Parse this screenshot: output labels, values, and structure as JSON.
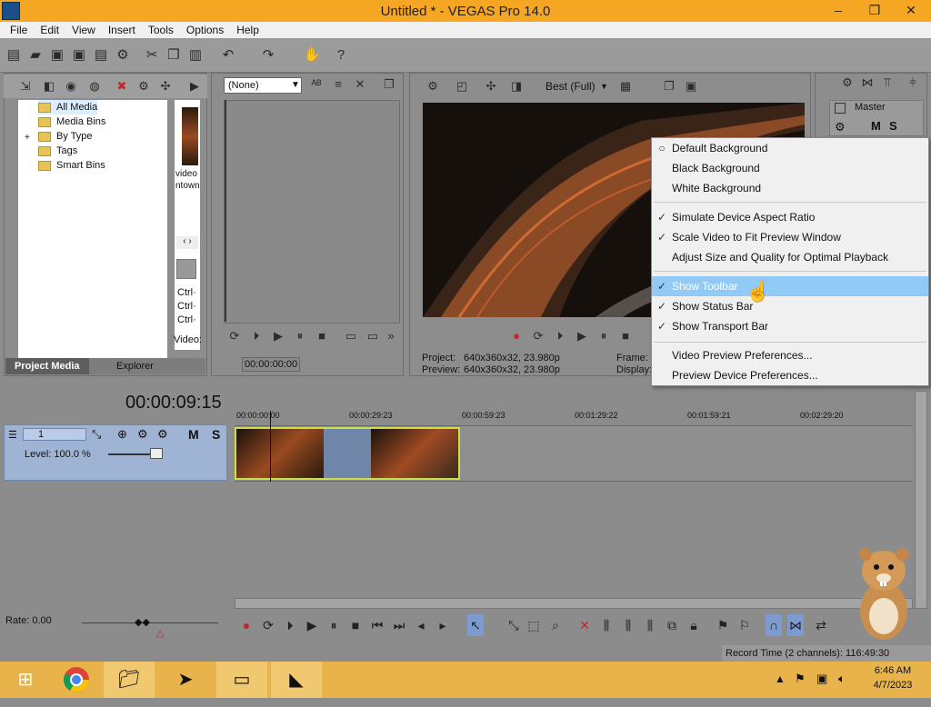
{
  "window": {
    "title": "Untitled * - VEGAS Pro 14.0",
    "minimize": "–",
    "restore": "❐",
    "close": "✕"
  },
  "menubar": {
    "items": [
      "File",
      "Edit",
      "View",
      "Insert",
      "Tools",
      "Options",
      "Help"
    ]
  },
  "project_media": {
    "tree": [
      "All Media",
      "Media Bins",
      "By Type",
      "Tags",
      "Smart Bins"
    ],
    "expand": "+",
    "strip_texts": [
      "video",
      "ntown"
    ],
    "tabs": [
      "Project Media",
      "Explorer"
    ]
  },
  "trimmer": {
    "select_value": "(None)",
    "timecode": "00:00:00:00",
    "ctrl_labels": [
      "Ctrl·",
      "Ctrl·",
      "Ctrl·"
    ],
    "video_label": "Video:"
  },
  "preview": {
    "quality": "Best (Full)",
    "project_label": "Project:",
    "project_value": "640x360x32, 23.980p",
    "preview_label": "Preview:",
    "preview_value": "640x360x32, 23.980p",
    "frame_label": "Frame:",
    "display_label": "Display:"
  },
  "mixer": {
    "master": "Master",
    "m": "M",
    "s": "S"
  },
  "context_menu": {
    "items": [
      {
        "label": "Default Background",
        "check": "○"
      },
      {
        "label": "Black Background",
        "check": ""
      },
      {
        "label": "White Background",
        "check": ""
      },
      {
        "label": "Simulate Device Aspect Ratio",
        "check": "✓"
      },
      {
        "label": "Scale Video to Fit Preview Window",
        "check": "✓"
      },
      {
        "label": "Adjust Size and Quality for Optimal Playback",
        "check": ""
      },
      {
        "label": "Show Toolbar",
        "check": "✓"
      },
      {
        "label": "Show Status Bar",
        "check": "✓"
      },
      {
        "label": "Show Transport Bar",
        "check": "✓"
      },
      {
        "label": "Video Preview Preferences...",
        "check": ""
      },
      {
        "label": "Preview Device Preferences...",
        "check": ""
      }
    ]
  },
  "timeline": {
    "timecode": "00:00:09:15",
    "track_number": "1",
    "level": "Level: 100.0 %",
    "m": "M",
    "s": "S",
    "ruler": [
      "00:00:00:00",
      "00:00:29:23",
      "00:00:59:23",
      "00:01:29:22",
      "00:01:59:21",
      "00:02:29:20"
    ],
    "rate": "Rate: 0.00"
  },
  "status": {
    "record_time": "Record Time (2 channels): 116:49:30"
  },
  "taskbar": {
    "time": "6:46 AM",
    "date": "4/7/2023"
  },
  "colors": {
    "title_bar": "#f5a623",
    "highlight": "#91c9f7",
    "clip_border": "#c9e04c",
    "taskbar": "#e8b34a"
  }
}
